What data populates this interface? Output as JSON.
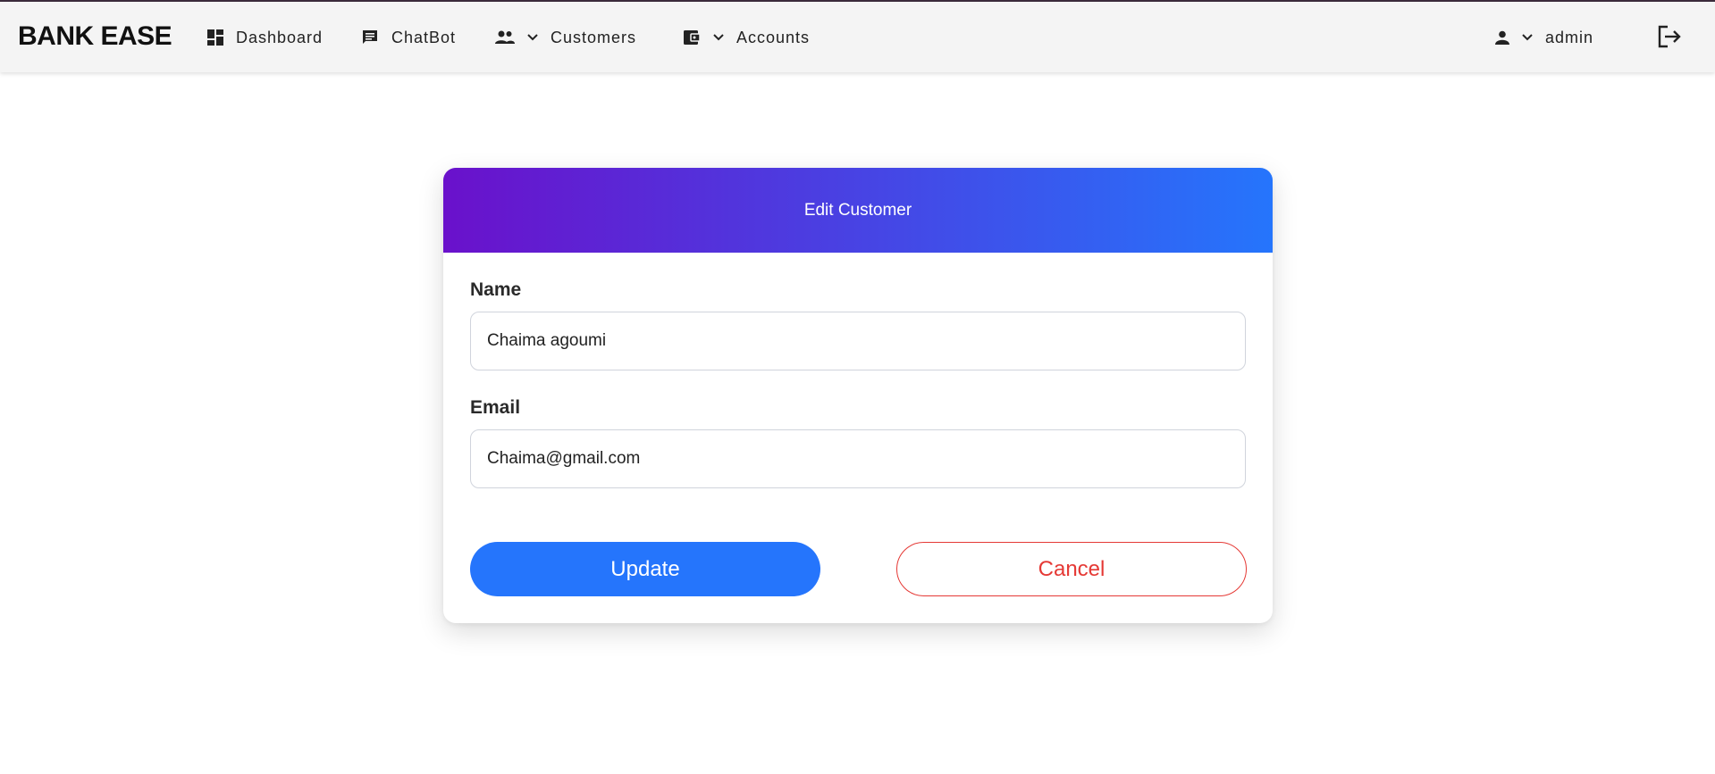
{
  "navbar": {
    "brand": "BANK EASE",
    "items": [
      {
        "label": "Dashboard",
        "icon": "dashboard-icon"
      },
      {
        "label": "ChatBot",
        "icon": "chat-icon"
      },
      {
        "label": "Customers",
        "icon": "people-icon",
        "dropdown": true
      },
      {
        "label": "Accounts",
        "icon": "wallet-icon",
        "dropdown": true
      }
    ],
    "user": {
      "label": "admin",
      "icon": "person-icon",
      "dropdown": true
    },
    "logout_icon": "logout-icon"
  },
  "form": {
    "title": "Edit Customer",
    "name_label": "Name",
    "name_value": "Chaima agoumi",
    "email_label": "Email",
    "email_value": "Chaima@gmail.com",
    "update_label": "Update",
    "cancel_label": "Cancel"
  },
  "colors": {
    "gradient_start": "#6a11cb",
    "gradient_end": "#2575fc",
    "primary": "#2575fc",
    "danger": "#e53935"
  }
}
